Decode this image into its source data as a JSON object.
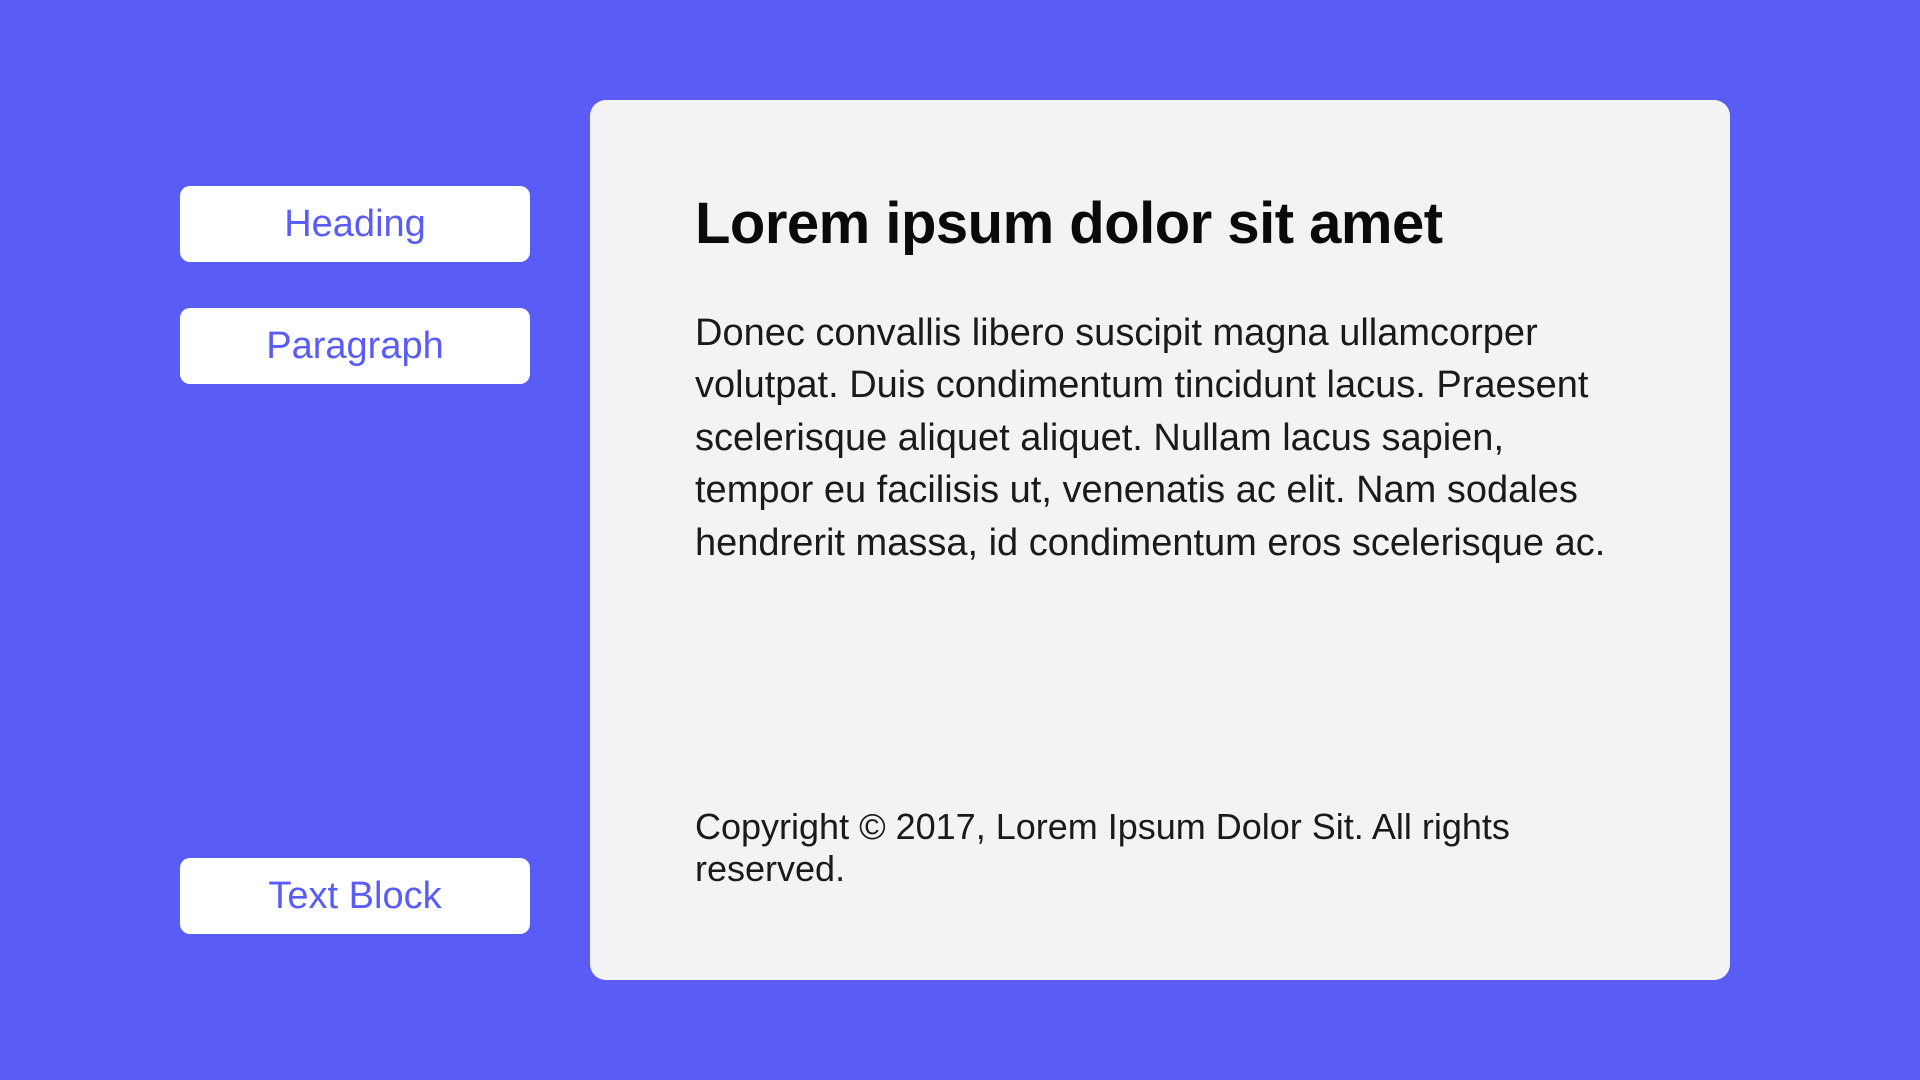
{
  "sidebar": {
    "buttons": {
      "heading": "Heading",
      "paragraph": "Paragraph",
      "textblock": "Text Block"
    }
  },
  "content": {
    "heading": "Lorem ipsum dolor sit amet",
    "paragraph": "Donec convallis libero suscipit magna ullamcorper volutpat. Duis condimentum tincidunt lacus. Praesent scelerisque aliquet aliquet. Nullam lacus sapien, tempor eu facilisis ut, venenatis ac elit. Nam sodales hendrerit massa, id condimentum eros scelerisque ac.",
    "footer": "Copyright © 2017, Lorem Ipsum Dolor Sit. All rights reserved."
  }
}
